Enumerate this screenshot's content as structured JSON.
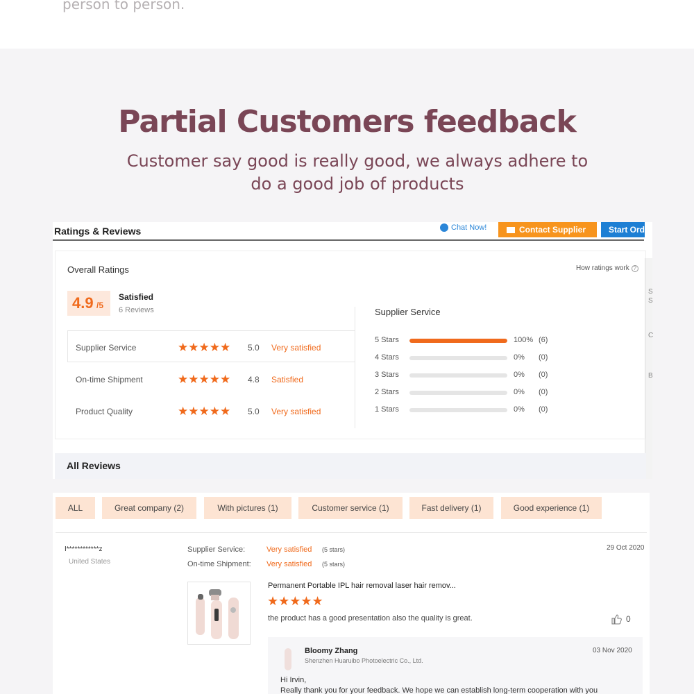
{
  "header": {
    "top_text": "person to person.",
    "title": "Partial Customers feedback",
    "subtitle": "Customer say good is really good, we always adhere to do a good job of products"
  },
  "panel": {
    "title": "Ratings & Reviews",
    "chat_now": "Chat Now!",
    "contact_supplier": "Contact Supplier",
    "start_order": "Start Ord",
    "side_letters": [
      "S",
      "S",
      "C",
      "B"
    ]
  },
  "overall": {
    "label": "Overall Ratings",
    "how_ratings_work": "How ratings work",
    "score": "4.9",
    "score_out_of": "/5",
    "verdict": "Satisfied",
    "reviews_count": "6 Reviews"
  },
  "categories": [
    {
      "name": "Supplier Service",
      "stars": "★★★★★",
      "rating": 5.0,
      "rating_text": "5.0",
      "label": "Very satisfied"
    },
    {
      "name": "On-time Shipment",
      "stars": "★★★★★",
      "rating": 4.8,
      "rating_text": "4.8",
      "label": "Satisfied"
    },
    {
      "name": "Product Quality",
      "stars": "★★★★★",
      "rating": 5.0,
      "rating_text": "5.0",
      "label": "Very satisfied"
    }
  ],
  "breakdown": {
    "title": "Supplier Service",
    "rows": [
      {
        "label": "5 Stars",
        "fraction": 1.0,
        "pct": "100%",
        "count": "(6)"
      },
      {
        "label": "4 Stars",
        "fraction": 0.0,
        "pct": "0%",
        "count": "(0)"
      },
      {
        "label": "3 Stars",
        "fraction": 0.0,
        "pct": "0%",
        "count": "(0)"
      },
      {
        "label": "2 Stars",
        "fraction": 0.0,
        "pct": "0%",
        "count": "(0)"
      },
      {
        "label": "1 Stars",
        "fraction": 0.0,
        "pct": "0%",
        "count": "(0)"
      }
    ]
  },
  "all_reviews": {
    "title": "All Reviews",
    "filters": [
      "ALL",
      "Great company (2)",
      "With pictures (1)",
      "Customer service (1)",
      "Fast delivery (1)",
      "Good experience (1)"
    ]
  },
  "review": {
    "reviewer": "I************z",
    "country": "United States",
    "meta": [
      {
        "label": "Supplier Service:",
        "value": "Very satisfied",
        "stars": "(5 stars)"
      },
      {
        "label": "On-time Shipment:",
        "value": "Very satisfied",
        "stars": "(5 stars)"
      }
    ],
    "date": "29 Oct 2020",
    "product_title": "Permanent Portable IPL hair removal laser hair remov...",
    "stars": "★★★★★",
    "text": "the product has a good presentation also the quality is great.",
    "likes": "0",
    "reply": {
      "name": "Bloomy Zhang",
      "company": "Shenzhen Huaruibo Photoelectric Co., Ltd.",
      "date": "03 Nov 2020",
      "greeting": "Hi Irvin,",
      "body": "Really thank you for your feedback. We hope we can establish long-term cooperation with you"
    }
  },
  "colors": {
    "accent_orange": "#f06a1c",
    "contact_button": "#f7941d",
    "start_button": "#1d7fd4",
    "title_color": "#7a4656",
    "filter_bg": "#fde4d3"
  }
}
